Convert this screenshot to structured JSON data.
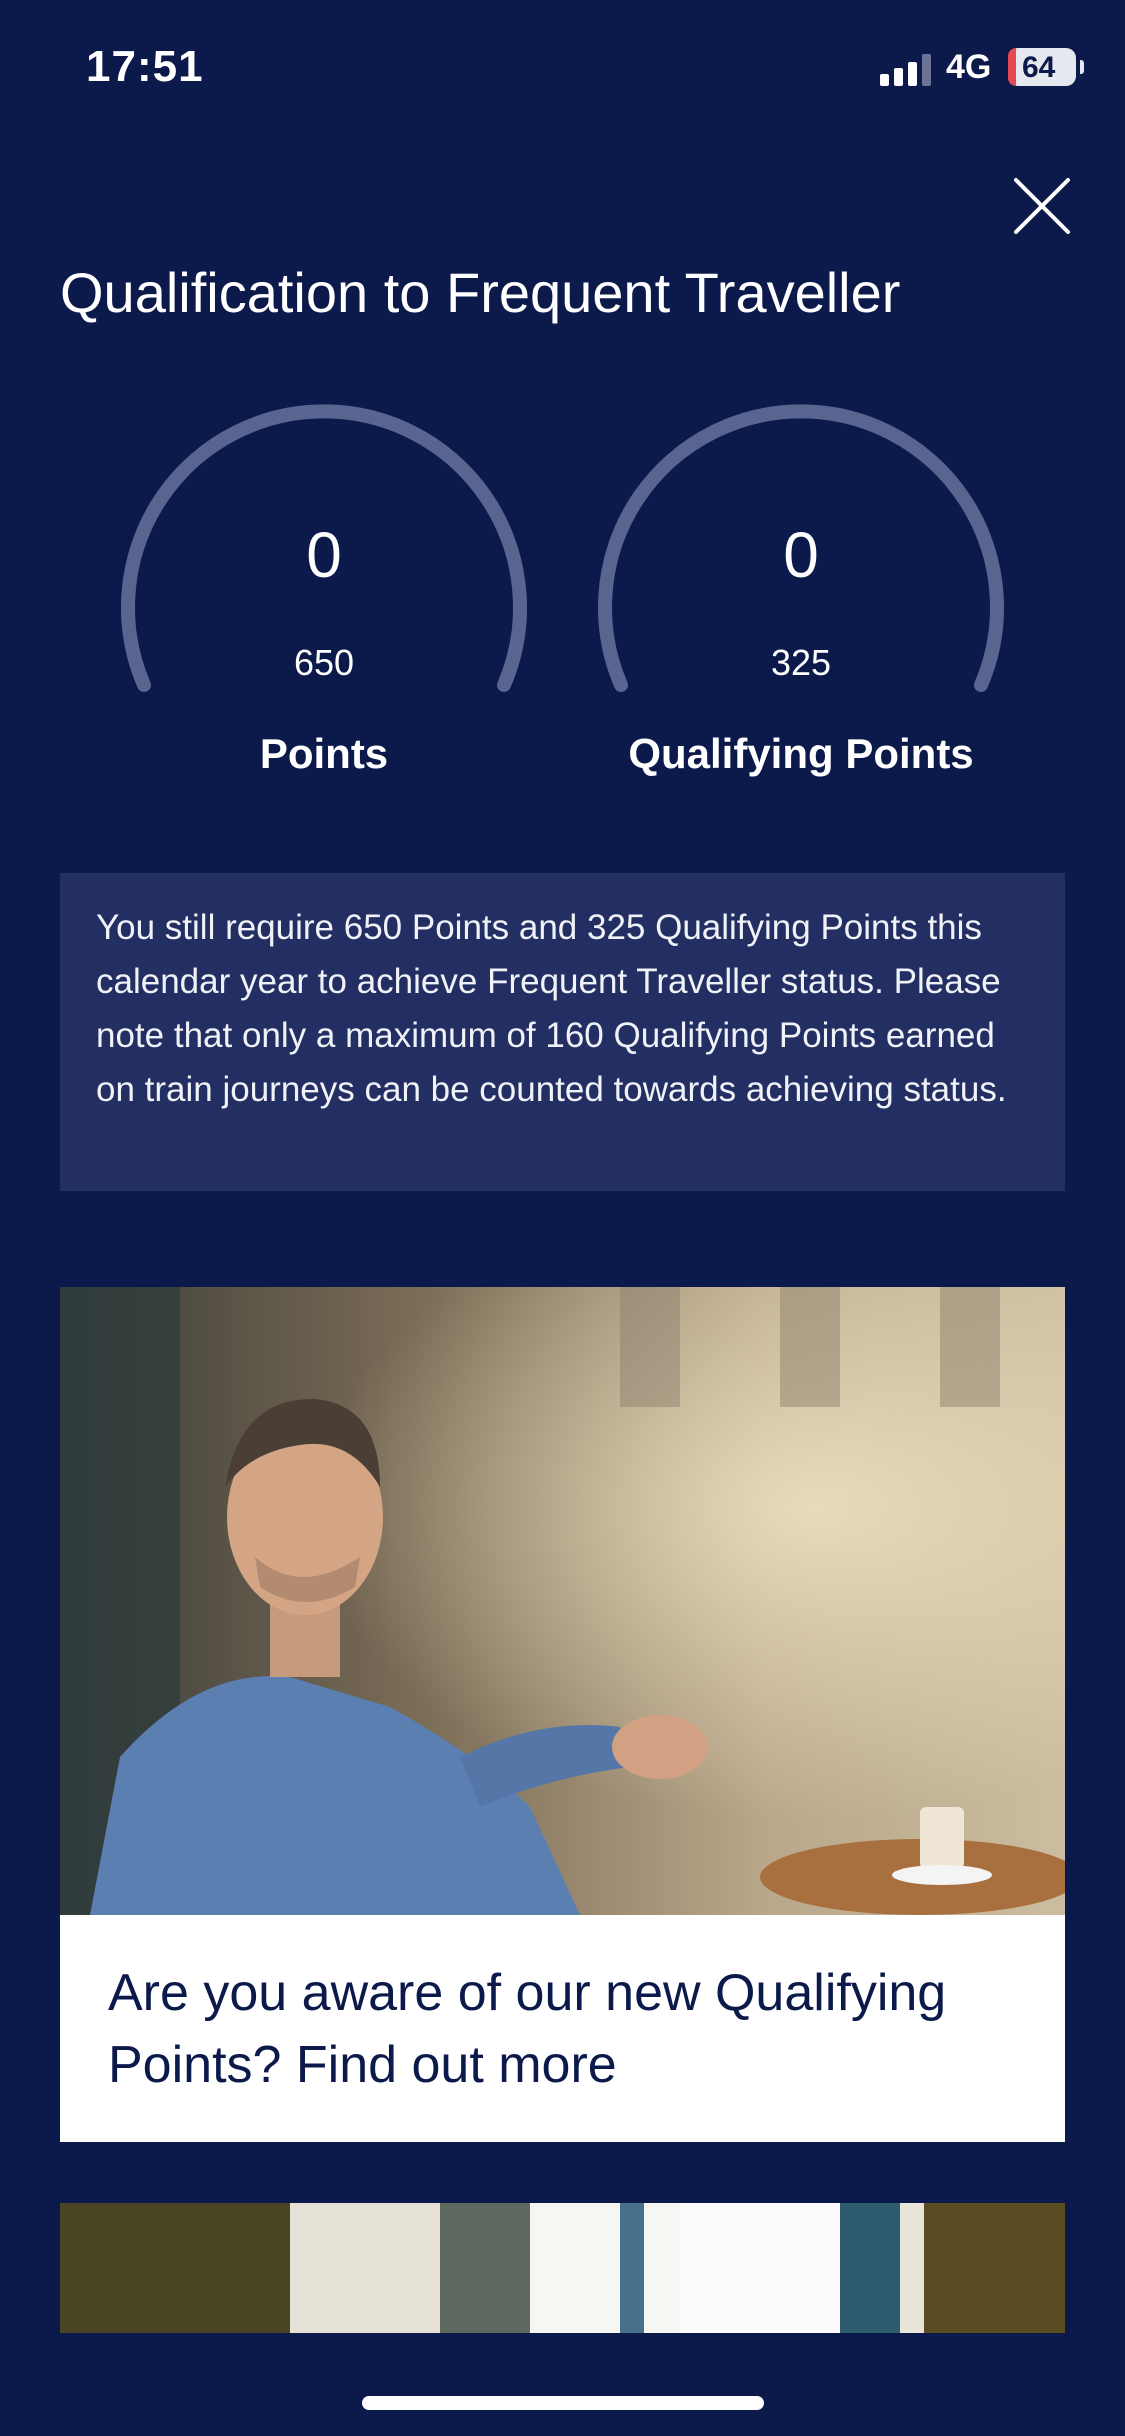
{
  "status_bar": {
    "time": "17:51",
    "network": "4G",
    "battery": "64"
  },
  "page": {
    "title": "Qualification to Frequent Traveller"
  },
  "gauges": [
    {
      "value": "0",
      "target": "650",
      "label": "Points",
      "progress": 0
    },
    {
      "value": "0",
      "target": "325",
      "label": "Qualifying Points",
      "progress": 0
    }
  ],
  "info": {
    "text": "You still require 650 Points and 325 Qualifying Points this calendar year to achieve Frequent Traveller status. Please note that only a maximum of 160 Qualifying Points earned on train journeys can be counted towards achieving status."
  },
  "promo": {
    "caption": "Are you aware of our new Qualifying Points? Find out more"
  },
  "colors": {
    "background": "#0c1a4b",
    "info_box": "#232f63",
    "gauge_track": "#5a6491",
    "caption_text": "#0c1a4b"
  },
  "icons": {
    "close": "close-icon",
    "signal": "signal-icon",
    "battery": "battery-icon"
  }
}
